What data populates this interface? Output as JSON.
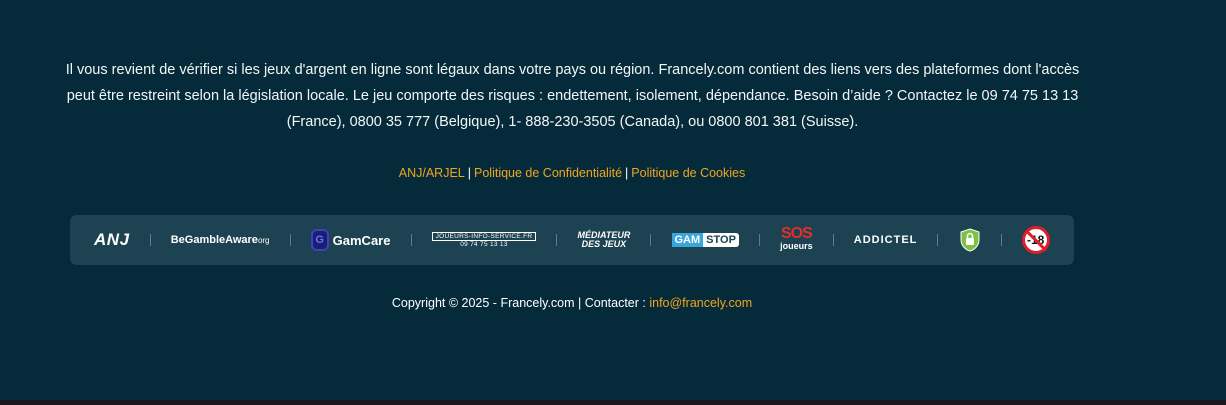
{
  "footer": {
    "disclaimer": "Il vous revient de vérifier si les jeux d'argent en ligne sont légaux dans votre pays ou région. Francely.com contient des liens vers des plateformes dont l'accès peut être restreint selon la législation locale. Le jeu comporte des risques : endettement, isolement, dépendance. Besoin d’aide ? Contactez le 09 74 75 13 13 (France), 0800 35 777 (Belgique), 1- 888-230-3505 (Canada), ou 0800 801 381 (Suisse).",
    "links": {
      "anj": "ANJ/ARJEL",
      "privacy": "Politique de Confidentialité",
      "cookies": "Politique de Cookies",
      "separator": "|"
    },
    "logos": {
      "anj": "ANJ",
      "begambleaware": "BeGambleAware",
      "begambleaware_suffix": "org",
      "gamcare": "GamCare",
      "joueurs_info_service": "JOUEURS-INFO-SERVICE.FR",
      "joueurs_phone": "09 74 75 13 13",
      "mediateur_line1": "MÉDIATEUR",
      "mediateur_line2": "DES JEUX",
      "gamstop_a": "GAM",
      "gamstop_b": "STOP",
      "sos_line1": "SOS",
      "sos_line2": "joueurs",
      "addictel": "ADDICTEL",
      "age_limit": "-18"
    },
    "copyright_text": "Copyright © 2025 - Francely.com | Contacter : ",
    "contact_email": "info@francely.com"
  },
  "colors": {
    "background": "#052b3b",
    "logo_bar": "#1d4251",
    "link_accent": "#f0a51c"
  }
}
